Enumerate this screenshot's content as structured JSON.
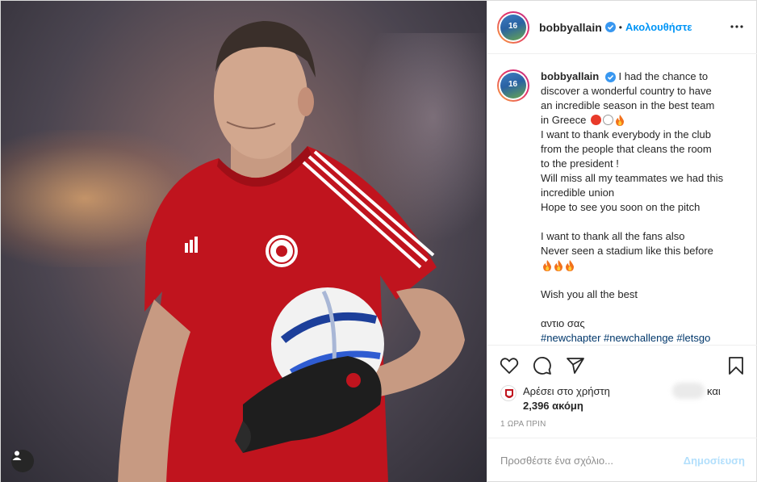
{
  "post": {
    "username": "bobbyallain",
    "follow_label": "Ακολουθήστε",
    "dot": "•",
    "caption_lines": [
      "I had the chance to",
      "discover a wonderful country to have",
      "an incredible season in the best team",
      "in Greece",
      "I want to thank everybody in the club",
      "from the people that cleans the room",
      "to the president !",
      "Will miss all my teammates we had this",
      "incredible union",
      "Hope to see you soon on the pitch",
      "I want to thank all the fans also",
      "Never seen a stadium like this before",
      "Wish you all the best",
      "αντιο σας",
      "#newchapter #newchallenge #letsgo"
    ],
    "avatar_number": "16"
  },
  "likes": {
    "liked_by": "Αρέσει στο χρήστη",
    "and": "και",
    "count": "2,396 ακόμη"
  },
  "timestamp": "1 ΩΡΑ ΠΡΙΝ",
  "comment_box": {
    "placeholder": "Προσθέστε ένα σχόλιο...",
    "post_label": "Δημοσίευση"
  },
  "colors": {
    "accent": "#0095f6",
    "verified": "#3897f0",
    "jersey_red": "#c0141e"
  },
  "icons": {
    "more": "more-options-icon",
    "like": "heart-icon",
    "comment": "comment-icon",
    "share": "share-icon",
    "save": "bookmark-icon",
    "user_tag": "user-tag-icon"
  }
}
